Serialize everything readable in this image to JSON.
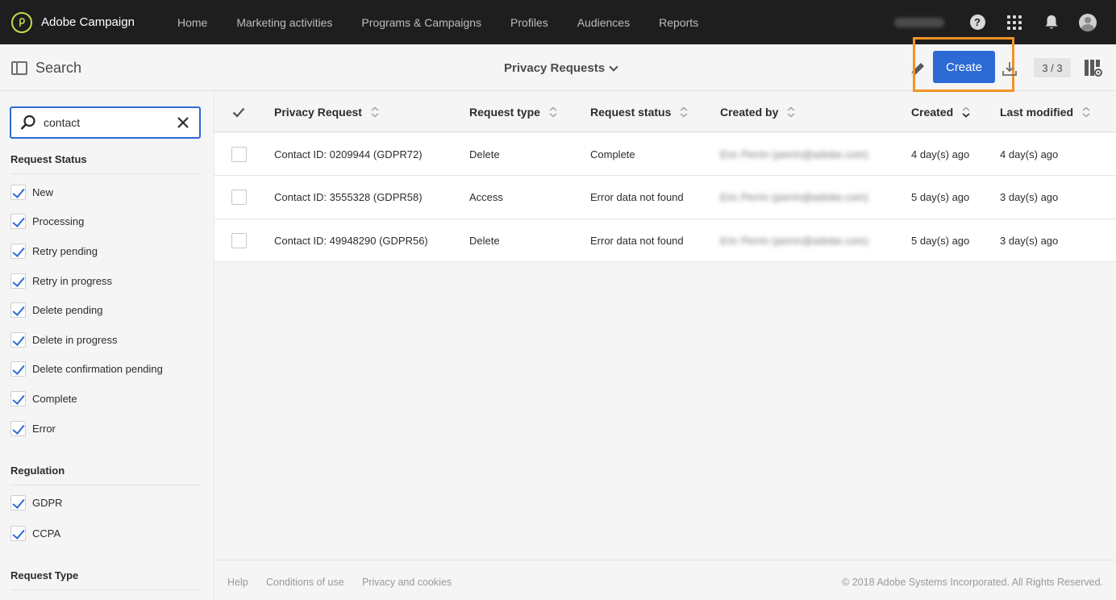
{
  "app": {
    "name": "Adobe Campaign",
    "nav": [
      "Home",
      "Marketing activities",
      "Programs & Campaigns",
      "Profiles",
      "Audiences",
      "Reports"
    ],
    "icons": [
      "help-icon",
      "app-grid-icon",
      "bell-icon",
      "avatar"
    ]
  },
  "subheader": {
    "search_title": "Search",
    "view_title": "Privacy Requests",
    "create_label": "Create",
    "count": "3 / 3"
  },
  "sidebar": {
    "search_value": "contact",
    "request_status_title": "Request Status",
    "request_status": [
      "New",
      "Processing",
      "Retry pending",
      "Retry in progress",
      "Delete pending",
      "Delete in progress",
      "Delete confirmation pending",
      "Complete",
      "Error"
    ],
    "regulation_title": "Regulation",
    "regulation": [
      "GDPR",
      "CCPA"
    ],
    "request_type_title": "Request Type"
  },
  "table": {
    "columns": [
      "Privacy Request",
      "Request type",
      "Request status",
      "Created by",
      "Created",
      "Last modified"
    ],
    "rows": [
      [
        "Contact ID: 0209944 (GDPR72)",
        "Delete",
        "Complete",
        "Eric Perrin (perrin@adobe.com)",
        "4 day(s) ago",
        "4 day(s) ago"
      ],
      [
        "Contact ID: 3555328 (GDPR58)",
        "Access",
        "Error data not found",
        "Eric Perrin (perrin@adobe.com)",
        "5 day(s) ago",
        "3 day(s) ago"
      ],
      [
        "Contact ID: 49948290 (GDPR56)",
        "Delete",
        "Error data not found",
        "Eric Perrin (perrin@adobe.com)",
        "5 day(s) ago",
        "3 day(s) ago"
      ]
    ]
  },
  "footer": {
    "links": [
      "Help",
      "Conditions of use",
      "Privacy and cookies"
    ],
    "copyright": "© 2018 Adobe Systems Incorporated. All Rights Reserved."
  },
  "colors": {
    "accent": "#2d6ad6",
    "highlight": "#f29423",
    "topbar": "#1e1e1e"
  }
}
